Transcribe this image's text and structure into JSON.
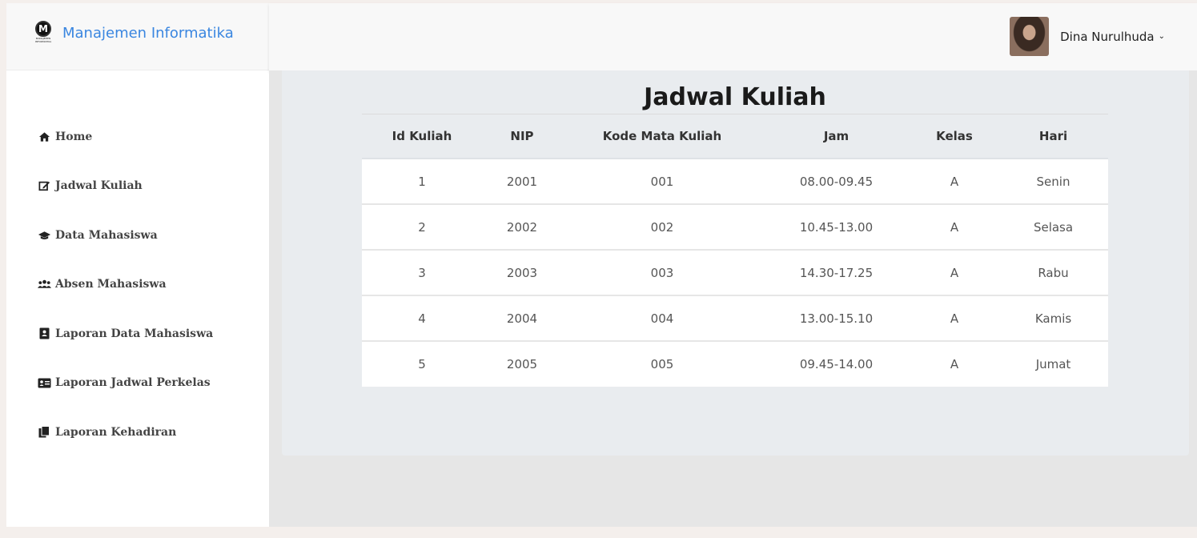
{
  "brand": {
    "title": "Manajemen Informatika",
    "logo_letter": "M",
    "logo_text_1": "MANAJEMEN",
    "logo_text_2": "INFORMATIKA"
  },
  "sidebar": {
    "items": [
      {
        "label": "Home",
        "icon": "home-icon"
      },
      {
        "label": "Jadwal Kuliah",
        "icon": "edit-icon"
      },
      {
        "label": "Data Mahasiswa",
        "icon": "graduation-cap-icon"
      },
      {
        "label": "Absen Mahasiswa",
        "icon": "users-icon"
      },
      {
        "label": "Laporan Data Mahasiswa",
        "icon": "address-book-icon"
      },
      {
        "label": "Laporan Jadwal Perkelas",
        "icon": "id-card-icon"
      },
      {
        "label": "Laporan Kehadiran",
        "icon": "copy-icon"
      }
    ]
  },
  "header": {
    "username": "Dina Nurulhuda",
    "caret": "⌄"
  },
  "main": {
    "title": "Jadwal Kuliah",
    "table": {
      "headers": [
        "Id Kuliah",
        "NIP",
        "Kode Mata Kuliah",
        "Jam",
        "Kelas",
        "Hari"
      ],
      "rows": [
        [
          "1",
          "2001",
          "001",
          "08.00-09.45",
          "A",
          "Senin"
        ],
        [
          "2",
          "2002",
          "002",
          "10.45-13.00",
          "A",
          "Selasa"
        ],
        [
          "3",
          "2003",
          "003",
          "14.30-17.25",
          "A",
          "Rabu"
        ],
        [
          "4",
          "2004",
          "004",
          "13.00-15.10",
          "A",
          "Kamis"
        ],
        [
          "5",
          "2005",
          "005",
          "09.45-14.00",
          "A",
          "Jumat"
        ]
      ]
    }
  },
  "colors": {
    "brand_blue": "#3a86e0",
    "panel_bg": "#e9ecef",
    "page_bg": "#f4efec"
  }
}
